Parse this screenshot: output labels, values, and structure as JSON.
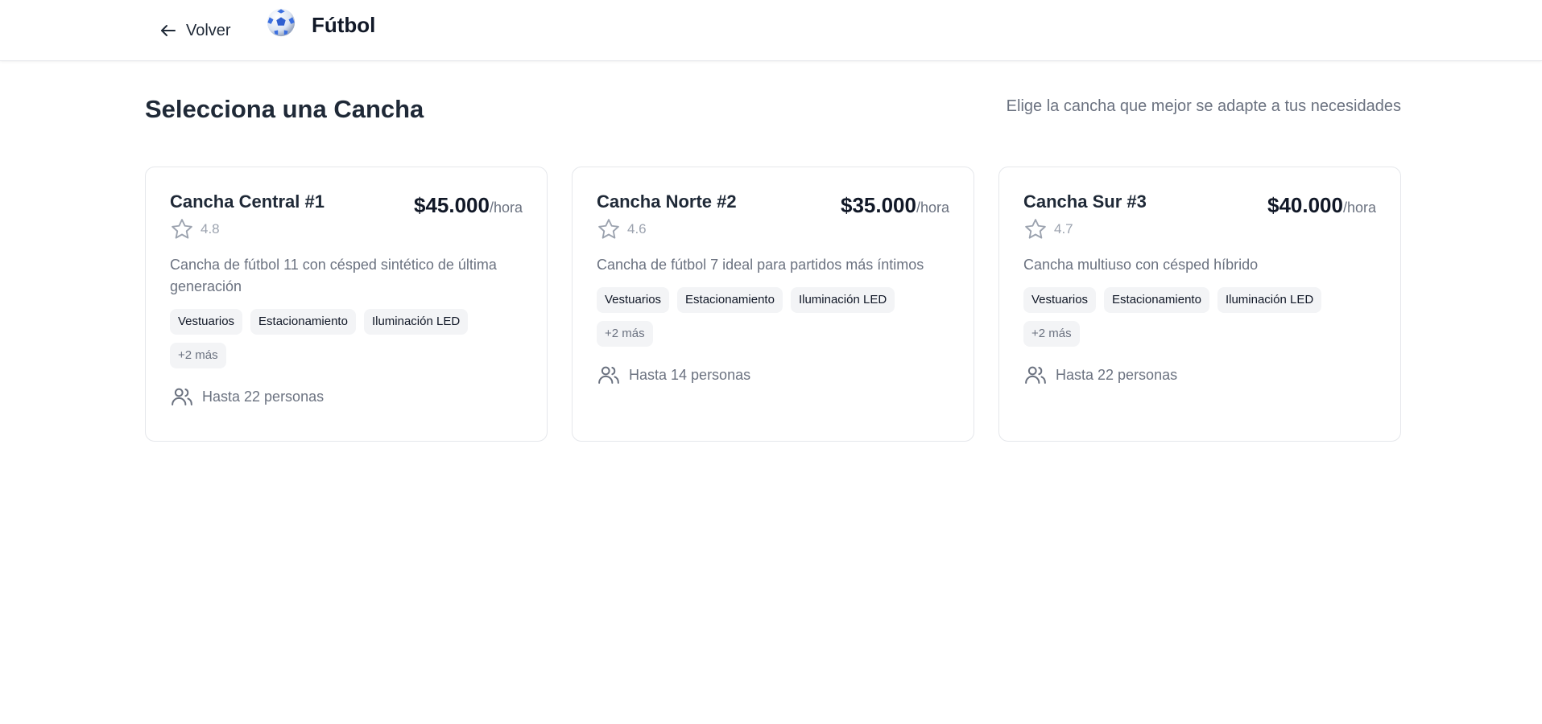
{
  "header": {
    "back_label": "Volver",
    "sport_title": "Fútbol",
    "sport_icon": "soccer-ball-icon"
  },
  "page": {
    "title": "Selecciona una Cancha",
    "subtitle": "Elige la cancha que mejor se adapte a tus necesidades"
  },
  "courts": [
    {
      "name": "Cancha Central #1",
      "rating": "4.8",
      "price": "$45.000",
      "price_unit": "/hora",
      "description": "Cancha de fútbol 11 con césped sintético de última generación",
      "tags": [
        "Vestuarios",
        "Estacionamiento",
        "Iluminación LED"
      ],
      "more": "+2 más",
      "capacity": "Hasta 22 personas"
    },
    {
      "name": "Cancha Norte #2",
      "rating": "4.6",
      "price": "$35.000",
      "price_unit": "/hora",
      "description": "Cancha de fútbol 7 ideal para partidos más íntimos",
      "tags": [
        "Vestuarios",
        "Estacionamiento",
        "Iluminación LED"
      ],
      "more": "+2 más",
      "capacity": "Hasta 14 personas"
    },
    {
      "name": "Cancha Sur #3",
      "rating": "4.7",
      "price": "$40.000",
      "price_unit": "/hora",
      "description": "Cancha multiuso con césped híbrido",
      "tags": [
        "Vestuarios",
        "Estacionamiento",
        "Iluminación LED"
      ],
      "more": "+2 más",
      "capacity": "Hasta 22 personas"
    }
  ],
  "colors": {
    "text_primary": "#1f2937",
    "text_muted": "#6b7280",
    "tag_bg": "#f3f4f6",
    "border": "#e5e7eb"
  }
}
